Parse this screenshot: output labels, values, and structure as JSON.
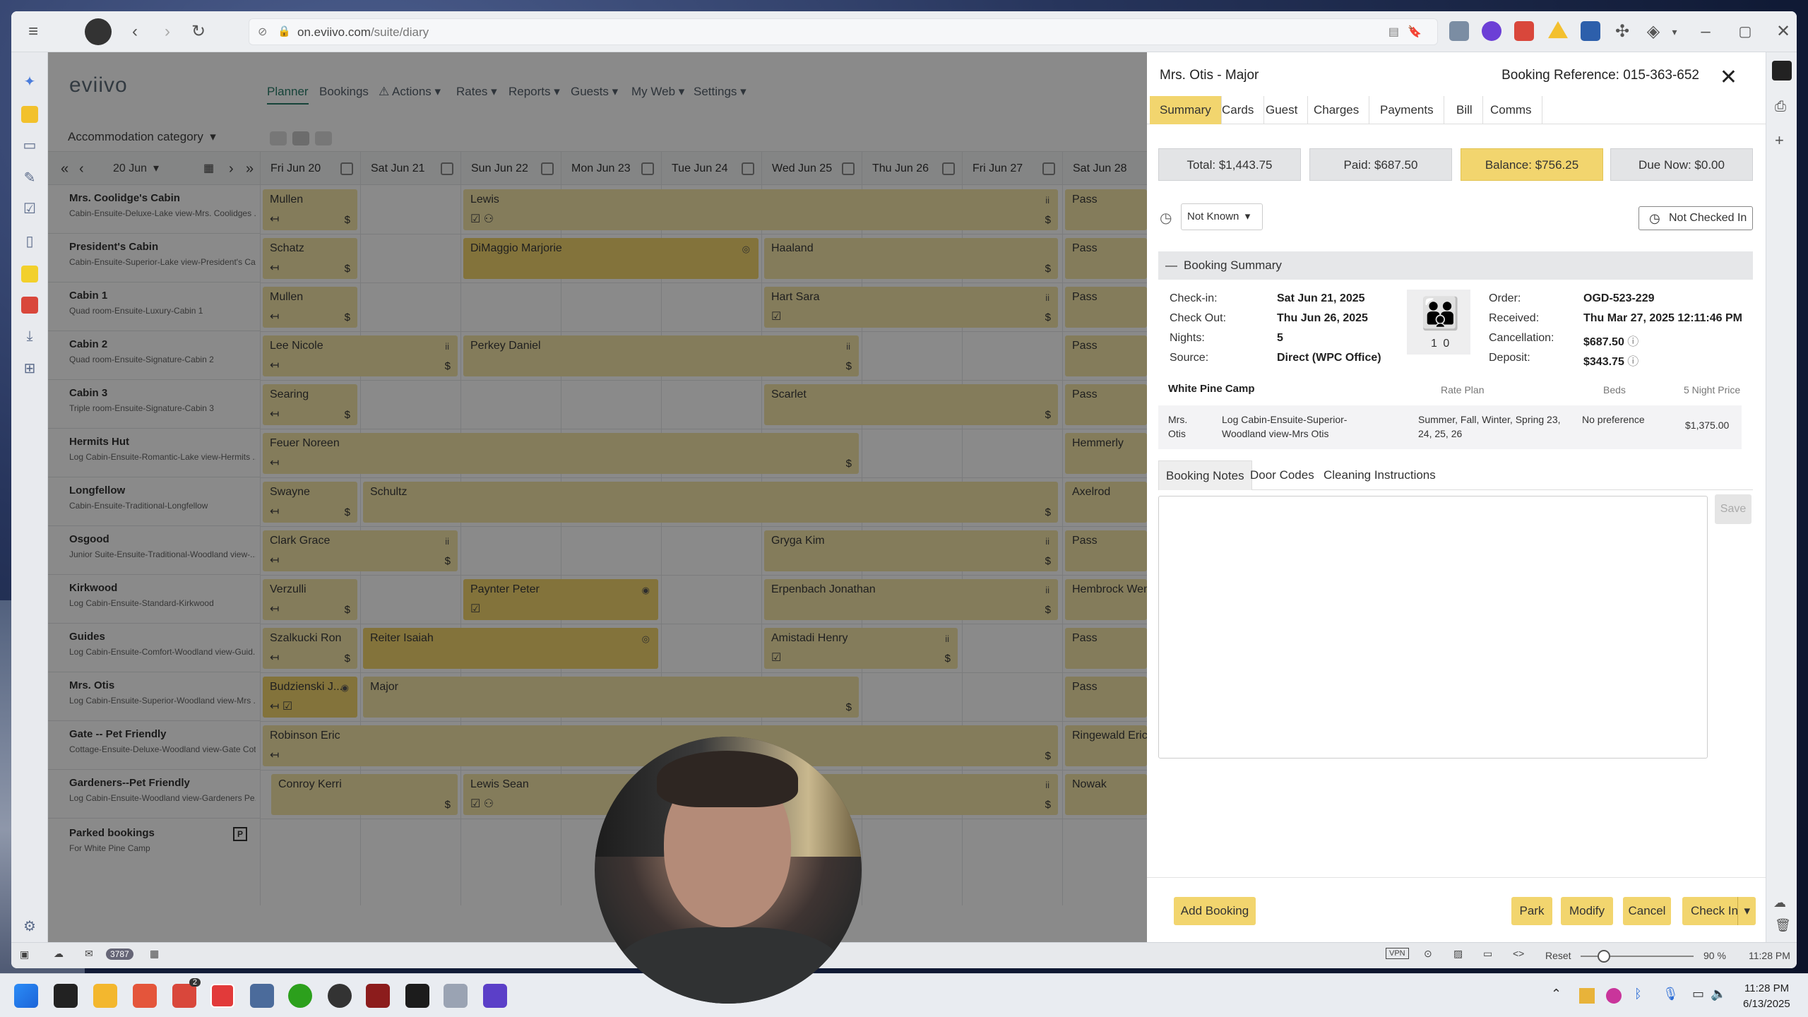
{
  "browser": {
    "url_host": "on.eviivo.com",
    "url_path": "/suite/diary",
    "status_badge": "3787",
    "reset_label": "Reset",
    "zoom": "90 %",
    "clock": "11:28 PM"
  },
  "app": {
    "logo": "eviivo",
    "nav": [
      "Planner",
      "Bookings",
      "Actions",
      "Rates",
      "Reports",
      "Guests",
      "My Web",
      "Settings"
    ],
    "category": "Accommodation category",
    "date": "20 Jun",
    "days": [
      "Fri Jun 20",
      "Sat Jun 21",
      "Sun Jun 22",
      "Mon Jun 23",
      "Tue Jun 24",
      "Wed Jun 25",
      "Thu Jun 26",
      "Fri Jun 27",
      "Sat Jun 28"
    ],
    "rooms": [
      {
        "name": "Mrs. Coolidge's Cabin",
        "sub": "Cabin-Ensuite-Deluxe-Lake view-Mrs. Coolidges ..."
      },
      {
        "name": "President's Cabin",
        "sub": "Cabin-Ensuite-Superior-Lake view-President's Ca..."
      },
      {
        "name": "Cabin 1",
        "sub": "Quad room-Ensuite-Luxury-Cabin 1"
      },
      {
        "name": "Cabin 2",
        "sub": "Quad room-Ensuite-Signature-Cabin 2"
      },
      {
        "name": "Cabin 3",
        "sub": "Triple room-Ensuite-Signature-Cabin 3"
      },
      {
        "name": "Hermits Hut",
        "sub": "Log Cabin-Ensuite-Romantic-Lake view-Hermits ..."
      },
      {
        "name": "Longfellow",
        "sub": "Cabin-Ensuite-Traditional-Longfellow"
      },
      {
        "name": "Osgood",
        "sub": "Junior Suite-Ensuite-Traditional-Woodland view-..."
      },
      {
        "name": "Kirkwood",
        "sub": "Log Cabin-Ensuite-Standard-Kirkwood"
      },
      {
        "name": "Guides",
        "sub": "Log Cabin-Ensuite-Comfort-Woodland view-Guid..."
      },
      {
        "name": "Mrs. Otis",
        "sub": "Log Cabin-Ensuite-Superior-Woodland view-Mrs ..."
      },
      {
        "name": "Gate -- Pet Friendly",
        "sub": "Cottage-Ensuite-Deluxe-Woodland view-Gate Cot..."
      },
      {
        "name": "Gardeners--Pet Friendly",
        "sub": "Log Cabin-Ensuite-Woodland view-Gardeners Pe..."
      }
    ],
    "parked": {
      "title": "Parked bookings",
      "sub": "For White Pine Camp",
      "badge": "P"
    },
    "bookings": [
      "Mullen",
      "Lewis",
      "Pass",
      "Schatz",
      "DiMaggio Marjorie",
      "Haaland",
      "Pass",
      "Mullen",
      "Hart Sara",
      "Pass",
      "Lee Nicole",
      "Perkey Daniel",
      "Pass",
      "Searing",
      "Scarlet",
      "Pass",
      "Feuer Noreen",
      "Hemmerly",
      "Swayne",
      "Schultz",
      "Axelrod",
      "Clark Grace",
      "Gryga Kim",
      "Pass",
      "Verzulli",
      "Paynter Peter",
      "Erpenbach Jonathan",
      "Hembrock Wen",
      "Szalkucki Ron",
      "Reiter Isaiah",
      "Amistadi Henry",
      "Pass",
      "Budzienski J...",
      "Major",
      "Pass",
      "Robinson Eric",
      "Ringewald Eric",
      "Conroy Kerri",
      "Lewis Sean",
      "Nowak"
    ]
  },
  "panel": {
    "title": "Mrs. Otis - Major",
    "ref": "Booking Reference: 015-363-652",
    "tabs": [
      "Summary",
      "Cards",
      "Guest",
      "Charges",
      "Payments",
      "Bill",
      "Comms"
    ],
    "total": "Total: $1,443.75",
    "paid": "Paid: $687.50",
    "balance": "Balance: $756.25",
    "due": "Due Now: $0.00",
    "arrival": "Not Known",
    "checked": "Not Checked In",
    "section": "Booking Summary",
    "checkin_l": "Check-in:",
    "checkin": "Sat Jun 21, 2025",
    "checkout_l": "Check Out:",
    "checkout": "Thu Jun 26, 2025",
    "nights_l": "Nights:",
    "nights": "5",
    "source_l": "Source:",
    "source": "Direct (WPC Office)",
    "guests_a": "1",
    "guests_c": "0",
    "order_l": "Order:",
    "order": "OGD-523-229",
    "received_l": "Received:",
    "received": "Thu Mar 27, 2025 12:11:46 PM",
    "cancel_l": "Cancellation:",
    "cancel": "$687.50",
    "deposit_l": "Deposit:",
    "deposit": "$343.75",
    "camp": "White Pine Camp",
    "h_rate": "Rate Plan",
    "h_beds": "Beds",
    "h_price": "5 Night Price",
    "r_guest": "Mrs. Otis",
    "r_room": "Log Cabin-Ensuite-Superior-Woodland view-Mrs Otis",
    "r_rate": "Summer, Fall, Winter, Spring 23, 24, 25, 26",
    "r_beds": "No preference",
    "r_price": "$1,375.00",
    "ntabs": [
      "Booking Notes",
      "Door Codes",
      "Cleaning Instructions"
    ],
    "save": "Save",
    "add": "Add Booking",
    "park": "Park",
    "modify": "Modify",
    "cancelb": "Cancel",
    "checkin_btn": "Check In"
  },
  "taskbar": {
    "time": "11:28 PM",
    "date": "6/13/2025",
    "badge": "2"
  }
}
